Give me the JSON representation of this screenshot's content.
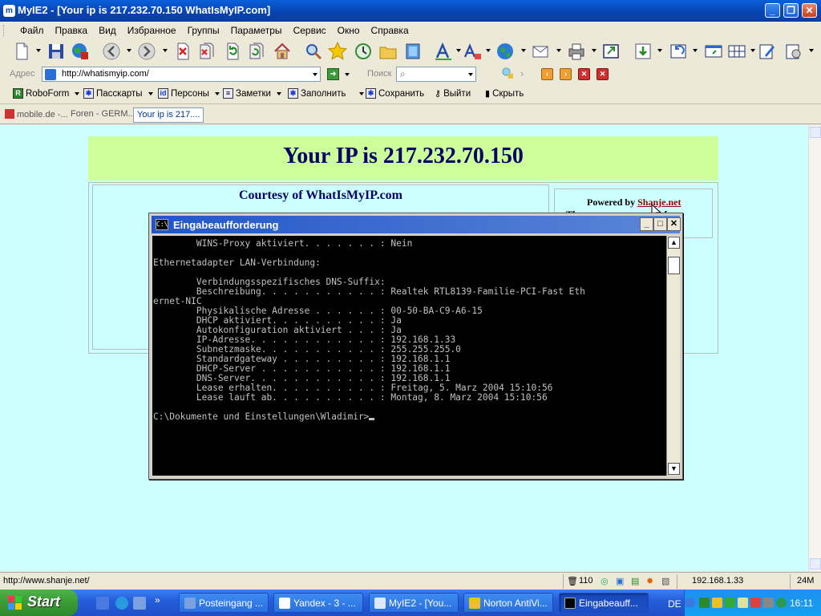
{
  "window": {
    "title": "MyIE2 - [Your ip is 217.232.70.150 WhatIsMyIP.com]"
  },
  "menu": [
    "Файл",
    "Правка",
    "Вид",
    "Избранное",
    "Группы",
    "Параметры",
    "Сервис",
    "Окно",
    "Справка"
  ],
  "address": {
    "label": "Адрес",
    "url": "http://whatismyip.com/",
    "search_label": "Поиск",
    "search_value": ""
  },
  "robobar": {
    "roboform": "RoboForm",
    "passcards": "Пасскарты",
    "identities": "Персоны",
    "notes": "Заметки",
    "fill": "Заполнить",
    "save": "Сохранить",
    "logoff": "Выйти",
    "hide": "Скрыть"
  },
  "tabs": [
    {
      "label": "mobile.de -..."
    },
    {
      "label": "Foren - GERM..."
    },
    {
      "label": "Your ip is 217...."
    }
  ],
  "page": {
    "ip_heading": "Your IP is 217.232.70.150",
    "courtesy": "Courtesy of WhatIsMyIP.com",
    "powered_by": "Powered by ",
    "powered_link": "Shanje.net",
    "powered_line2_left": "The",
    "powered_line2_right": "for"
  },
  "console": {
    "title": "Eingabeaufforderung",
    "output": "        WINS-Proxy aktiviert. . . . . . . : Nein\n\nEthernetadapter LAN-Verbindung:\n\n        Verbindungsspezifisches DNS-Suffix:\n        Beschreibung. . . . . . . . . . . : Realtek RTL8139-Familie-PCI-Fast Eth\nernet-NIC\n        Physikalische Adresse . . . . . . : 00-50-BA-C9-A6-15\n        DHCP aktiviert. . . . . . . . . . : Ja\n        Autokonfiguration aktiviert . . . : Ja\n        IP-Adresse. . . . . . . . . . . . : 192.168.1.33\n        Subnetzmaske. . . . . . . . . . . : 255.255.255.0\n        Standardgateway . . . . . . . . . : 192.168.1.1\n        DHCP-Server . . . . . . . . . . . : 192.168.1.1\n        DNS-Server. . . . . . . . . . . . : 192.168.1.1\n        Lease erhalten. . . . . . . . . . : Freitag, 5. Marz 2004 15:10:56\n        Lease lauft ab. . . . . . . . . . : Montag, 8. Marz 2004 15:10:56\n\n",
    "prompt": "C:\\Dokumente und Einstellungen\\Wladimir>"
  },
  "statusbar": {
    "url": "http://www.shanje.net/",
    "count": "110",
    "ip": "192.168.1.33",
    "memory": "24M"
  },
  "taskbar": {
    "start": "Start",
    "tasks": [
      {
        "label": "Posteingang ..."
      },
      {
        "label": "Yandex - 3 - ..."
      },
      {
        "label": "MyIE2 - [You..."
      },
      {
        "label": "Norton AntiVi..."
      },
      {
        "label": "Eingabeauff..."
      }
    ],
    "lang": "DE",
    "clock": "16:11"
  },
  "colors": {
    "page_bg": "#ccffff",
    "banner_bg": "#ccff99",
    "heading": "#000066",
    "link": "#990000"
  }
}
